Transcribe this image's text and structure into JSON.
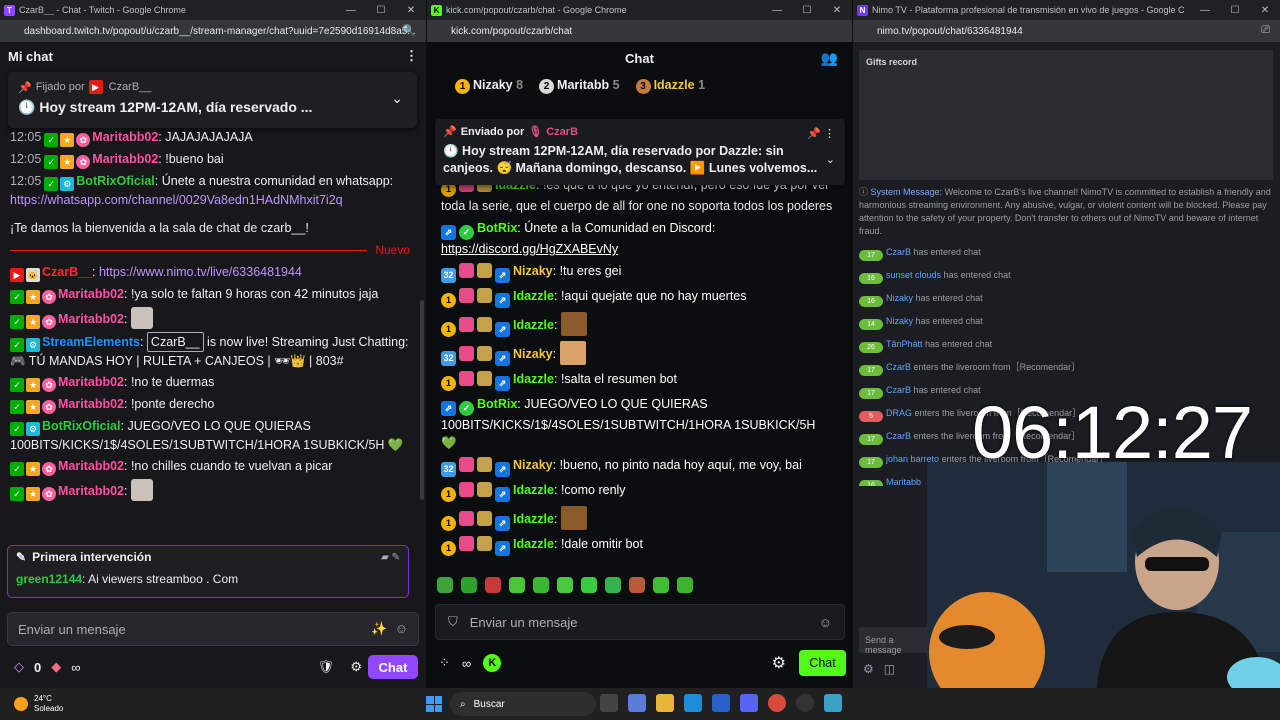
{
  "twitch": {
    "tab_title": "CzarB__ - Chat - Twitch - Google Chrome",
    "url": "dashboard.twitch.tv/popout/u/czarb__/stream-manager/chat?uuid=7e2590d16914d8a5...",
    "header": "Mi chat",
    "pinned_by_label": "Fijado por",
    "pinned_user": "CzarB__",
    "pinned_message": "Hoy stream 12PM-12AM, día reservado ...",
    "messages": [
      {
        "time": "12:05",
        "user": "Maritabb02",
        "text": "JAJAJAJAJAJA"
      },
      {
        "time": "12:05",
        "user": "Maritabb02",
        "text": "!bueno bai"
      },
      {
        "time": "12:05",
        "user": "BotRixOficial",
        "text": "Únete a nuestra comunidad en whatsapp:",
        "link": "https://whatsapp.com/channel/0029Va8edn1HAdNMhxit7i2q"
      }
    ],
    "welcome": "¡Te damos la bienvenida a la sala de chat de czarb__!",
    "new_label": "Nuevo",
    "msg_nimo_user": "CzarB__",
    "msg_nimo_link": "https://www.nimo.tv/live/6336481944",
    "msg_a": {
      "user": "Maritabb02",
      "text": "!ya solo te faltan 9 horas con 42 minutos jaja"
    },
    "msg_b": {
      "user": "Maritabb02"
    },
    "msg_se": {
      "user": "StreamElements",
      "tag": "CzarB__",
      "text1": " is now live! Streaming Just Chatting: ",
      "text2": "🎮 TÚ MANDAS HOY | RULETA + CANJEOS | ",
      "text3": " | 803#"
    },
    "msg_c": {
      "user": "Maritabb02",
      "text": "!no te duermas"
    },
    "msg_d": {
      "user": "Maritabb02",
      "text": "!ponte derecho"
    },
    "msg_e": {
      "user": "BotRixOficial",
      "text": "JUEGO/VEO LO QUE QUIERAS 100BITS/KICKS/1$/4SOLES/1SUBTWITCH/1HORA 1SUBKICK/5H 💚"
    },
    "msg_f": {
      "user": "Maritabb02",
      "text": "!no chilles cuando te vuelvan a picar"
    },
    "msg_g": {
      "user": "Maritabb02"
    },
    "first_title": "Primera intervención",
    "first_user": "green12144",
    "first_text": "Ai viewers streamboo . Com",
    "input_placeholder": "Enviar un mensaje",
    "points": "0",
    "infinity": "∞",
    "chat_button": "Chat"
  },
  "kick": {
    "tab_title": "kick.com/popout/czarb/chat - Google Chrome",
    "url": "kick.com/popout/czarb/chat",
    "header": "Chat",
    "top": [
      {
        "rank": "1",
        "user": "Nizaky",
        "count": "8",
        "color": "#f5b400"
      },
      {
        "rank": "2",
        "user": "Maritabb",
        "count": "5",
        "color": "#d8d8d8"
      },
      {
        "rank": "3",
        "user": "Idazzle",
        "count": "1",
        "color": "#c77b3b"
      }
    ],
    "pinned_by_label": "Enviado por",
    "pinned_user": "CzarB",
    "pinned_message": "🕛 Hoy stream 12PM-12AM, día reservado por Dazzle: sin canjeos. 😴 Mañana domingo, descanso. ▶️ Lunes volvemos...",
    "partial": {
      "user": "Idazzle",
      "text": "!es que a lo que yo entendí, pero eso fue ya por ver toda la serie, que el cuerpo de all for one no soporta todos los poderes"
    },
    "botrix1": {
      "user": "BotRix",
      "text": "Únete a la Comunidad en Discord:",
      "link": "https://discord.gg/HgZXABEvNy"
    },
    "m1": {
      "user": "Nizaky",
      "text": "!tu eres gei"
    },
    "m2": {
      "user": "Idazzle",
      "text": "!aqui quejate que no hay muertes"
    },
    "m3": {
      "user": "Idazzle"
    },
    "m4": {
      "user": "Nizaky"
    },
    "m5": {
      "user": "Idazzle",
      "text": "!salta el resumen bot"
    },
    "botrix2": {
      "user": "BotRix",
      "text": "JUEGO/VEO LO QUE QUIERAS 100BITS/KICKS/1$/4SOLES/1SUBTWITCH/1HORA 1SUBKICK/5H 💚"
    },
    "m6": {
      "user": "Nizaky",
      "text": "!bueno, no pinto nada hoy aquí, me voy, bai"
    },
    "m7": {
      "user": "Idazzle",
      "text": "!como renly"
    },
    "m8": {
      "user": "Idazzle"
    },
    "m9": {
      "user": "Idazzle",
      "text": "!dale omitir bot"
    },
    "input_placeholder": "Enviar un mensaje",
    "chat_button": "Chat"
  },
  "nimo": {
    "tab_title": "Nimo TV - Plataforma profesional de transmisión en vivo de juegos - Google Chrome",
    "url": "nimo.tv/popout/chat/6336481944",
    "gifts": "Gifts record",
    "system_label": "System Message:",
    "system_text": "Welcome to CzarB's live channel! NimoTV is committed to establish a friendly and harmonious streaming environment. Any abusive, vulgar, or violent content will be blocked. Please pay attention to the safety of your property. Don't transfer to others out of NimoTV and beware of internet fraud.",
    "events": [
      {
        "lvl": "17",
        "user": "CzarB",
        "text": "has entered chat"
      },
      {
        "lvl": "16",
        "user": "sunset clouds",
        "text": "has entered chat"
      },
      {
        "lvl": "16",
        "user": "Nizaky",
        "text": "has entered chat"
      },
      {
        "lvl": "14",
        "user": "Nizaky",
        "text": "has entered chat"
      },
      {
        "lvl": "26",
        "user": "TânPhátt",
        "text": "has entered chat"
      },
      {
        "lvl": "17",
        "user": "CzarB",
        "text": "enters the liveroom from［Recomendar］"
      },
      {
        "lvl": "17",
        "user": "CzarB",
        "text": "has entered chat"
      },
      {
        "lvl": "5",
        "user": "DRAG",
        "text": "enters the liveroom from［Recomendar］"
      },
      {
        "lvl": "17",
        "user": "CzarB",
        "text": "enters the liveroom from［Recomendar］"
      },
      {
        "lvl": "17",
        "user": "johan barreto",
        "text": "enters the liveroom from［Recomendar］"
      },
      {
        "lvl": "16",
        "user": "Maritabb",
        "text": ""
      }
    ],
    "input_placeholder": "Send a message"
  },
  "overlay": {
    "clock": "06:12:27"
  },
  "taskbar": {
    "temp": "24°C",
    "weather": "Soleado",
    "search": "Buscar"
  }
}
